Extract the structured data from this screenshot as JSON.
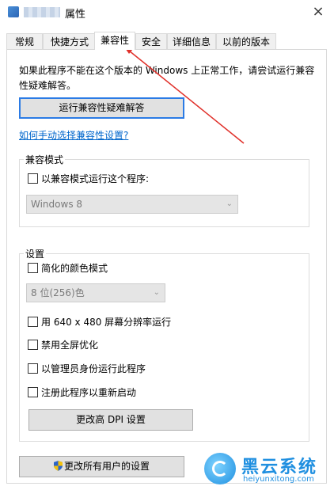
{
  "window": {
    "title": "属性",
    "close_glyph": "×"
  },
  "tabs": [
    {
      "label": "常规"
    },
    {
      "label": "快捷方式"
    },
    {
      "label": "兼容性"
    },
    {
      "label": "安全"
    },
    {
      "label": "详细信息"
    },
    {
      "label": "以前的版本"
    }
  ],
  "active_tab": "兼容性",
  "intro_text": "如果此程序不能在这个版本的 Windows 上正常工作，请尝试运行兼容性疑难解答。",
  "troubleshoot_button": "运行兼容性疑难解答",
  "manual_link": "如何手动选择兼容性设置?",
  "compat_mode": {
    "group_label": "兼容模式",
    "checkbox_label": "以兼容模式运行这个程序:",
    "checked": false,
    "select_value": "Windows 8"
  },
  "settings": {
    "group_label": "设置",
    "reduced_color": {
      "label": "简化的颜色模式",
      "checked": false
    },
    "color_select_value": "8 位(256)色",
    "run_640": {
      "label": "用 640 x 480 屏幕分辨率运行",
      "checked": false
    },
    "disable_fullscreen": {
      "label": "禁用全屏优化",
      "checked": false
    },
    "run_as_admin": {
      "label": "以管理员身份运行此程序",
      "checked": false
    },
    "register_restart": {
      "label": "注册此程序以重新启动",
      "checked": false
    },
    "dpi_button": "更改高 DPI 设置"
  },
  "all_users_button": "更改所有用户的设置",
  "annotation": {
    "color": "#e0302a"
  },
  "watermark": {
    "name": "黑云系统",
    "url": "heiyunxitong.com"
  },
  "colors": {
    "link": "#0066cc",
    "focus": "#2b7be5",
    "watermark": "#1f8fe0"
  }
}
